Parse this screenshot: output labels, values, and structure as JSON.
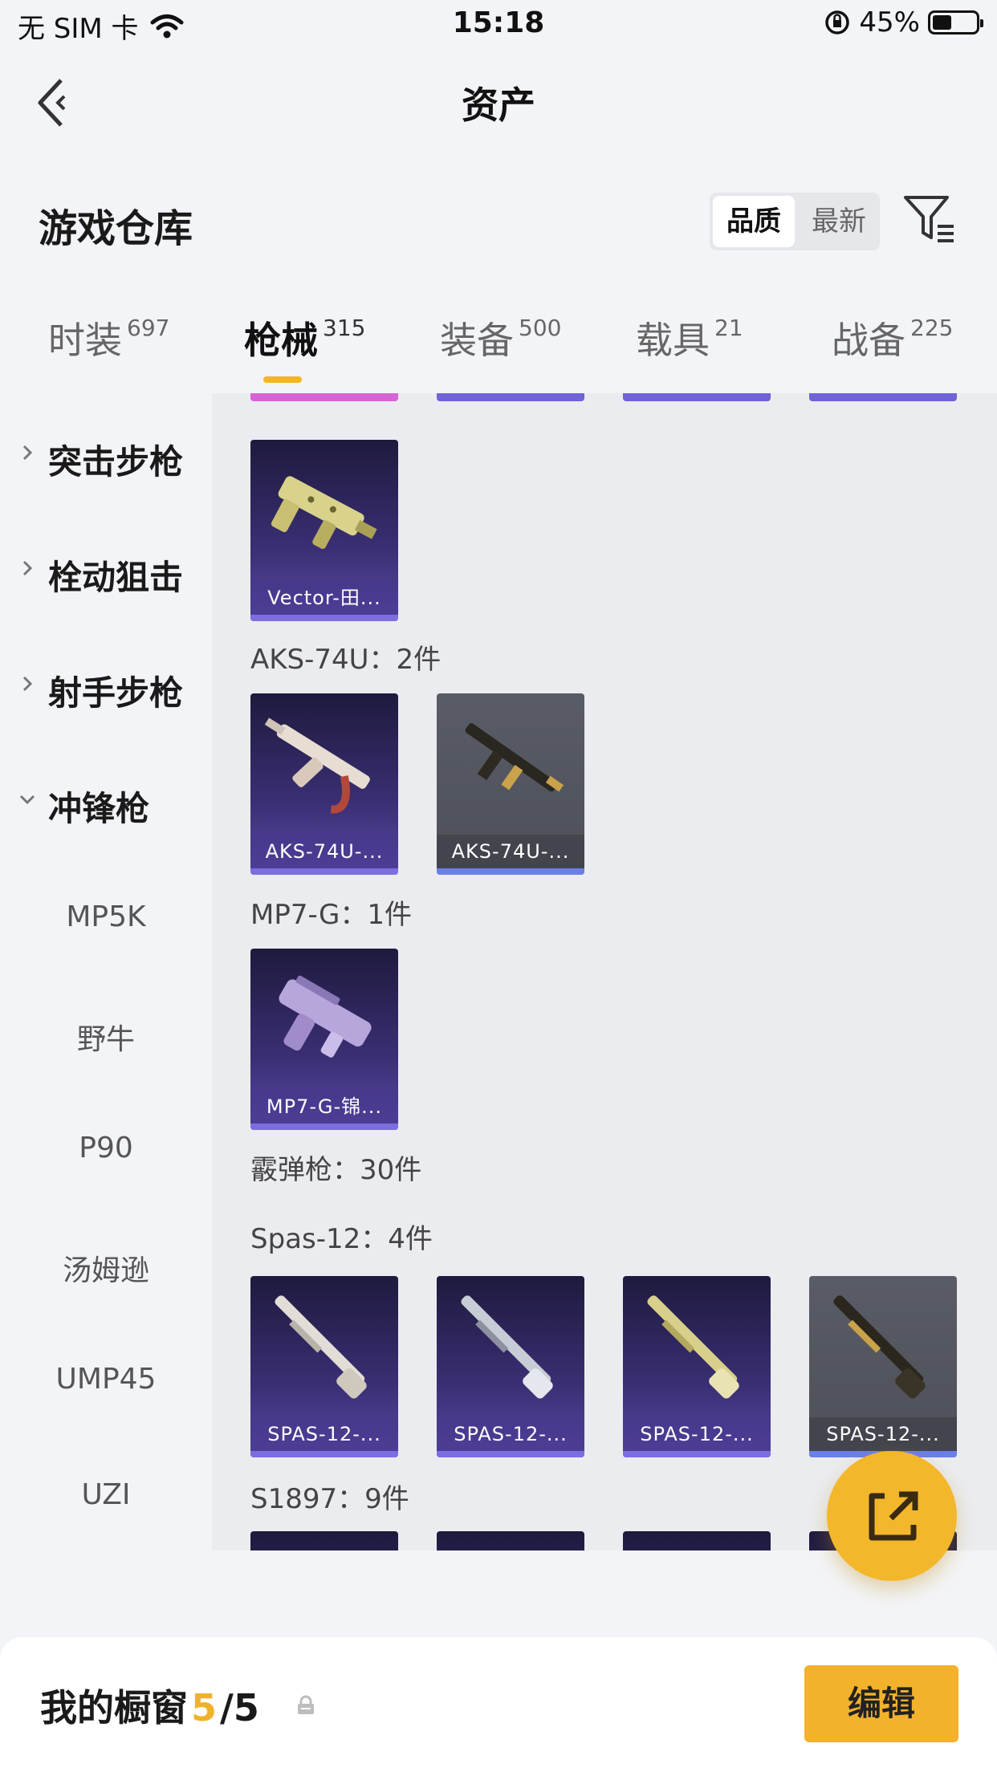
{
  "status_bar": {
    "carrier": "无 SIM 卡",
    "time": "15:18",
    "battery": "45%",
    "battery_level": 0.45
  },
  "nav": {
    "title": "资产"
  },
  "warehouse": {
    "title": "游戏仓库",
    "sort_options": [
      "品质",
      "最新"
    ],
    "sort_selected": "品质"
  },
  "tabs": [
    {
      "label": "时装",
      "count": "697"
    },
    {
      "label": "枪械",
      "count": "315"
    },
    {
      "label": "装备",
      "count": "500"
    },
    {
      "label": "载具",
      "count": "21"
    },
    {
      "label": "战备",
      "count": "225"
    }
  ],
  "sidebar": {
    "categories": [
      "突击步枪",
      "栓动狙击",
      "射手步枪",
      "冲锋枪"
    ],
    "subitems": [
      "MP5K",
      "野牛",
      "P90",
      "汤姆逊",
      "UMP45",
      "UZI"
    ]
  },
  "content": {
    "groups": [
      {
        "label": "AKS-74U：2件"
      },
      {
        "label": "MP7-G：1件"
      },
      {
        "label": "霰弹枪：30件"
      },
      {
        "label": "Spas-12：4件"
      },
      {
        "label": "S1897：9件"
      }
    ],
    "cards": {
      "vector": "Vector-田...",
      "aks1": "AKS-74U-...",
      "aks2": "AKS-74U-...",
      "mp7": "MP7-G-锦...",
      "spas1": "SPAS-12-...",
      "spas2": "SPAS-12-...",
      "spas3": "SPAS-12-...",
      "spas4": "SPAS-12-..."
    }
  },
  "showcase": {
    "title": "我的橱窗",
    "current": "5",
    "total": "/5",
    "edit_label": "编辑"
  },
  "colors": {
    "accent": "#f3b22b",
    "card_purple": "#3a2f74",
    "card_grey": "#595c66"
  }
}
